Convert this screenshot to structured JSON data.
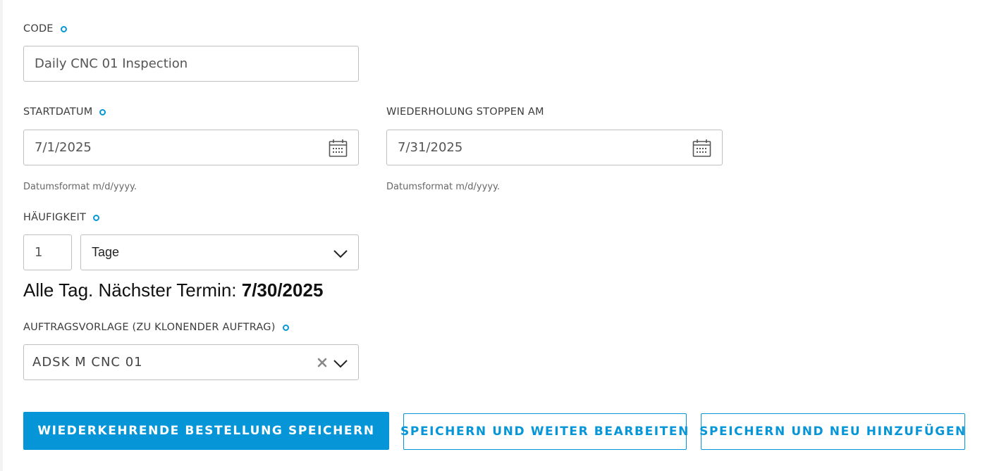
{
  "form": {
    "code": {
      "label": "CODE",
      "value": "Daily CNC 01 Inspection"
    },
    "start_date": {
      "label": "STARTDATUM",
      "value": "7/1/2025",
      "hint": "Datumsformat m/d/yyyy."
    },
    "stop_repeat": {
      "label": "WIEDERHOLUNG STOPPEN AM",
      "value": "7/31/2025",
      "hint": "Datumsformat m/d/yyyy."
    },
    "frequency": {
      "label": "HÄUFIGKEIT",
      "count": "1",
      "unit": "Tage"
    },
    "summary": {
      "prefix": "Alle Tag. Nächster Termin: ",
      "next_date": "7/30/2025"
    },
    "template": {
      "label": "AUFTRAGSVORLAGE (ZU KLONENDER AUFTRAG)",
      "value": "ADSK M CNC 01"
    }
  },
  "buttons": {
    "save": "WIEDERKEHRENDE BESTELLUNG SPEICHERN",
    "save_continue": "SPEICHERN UND WEITER BEARBEITEN",
    "save_new": "SPEICHERN UND NEU HINZUFÜGEN"
  },
  "icons": {
    "required": "required-dot-icon",
    "calendar": "calendar-icon",
    "dropdown": "chevron-down-icon",
    "clear": "clear-x-icon"
  },
  "colors": {
    "accent": "#0696d7",
    "border": "#bfbfbf",
    "text": "#3c3c3c"
  }
}
